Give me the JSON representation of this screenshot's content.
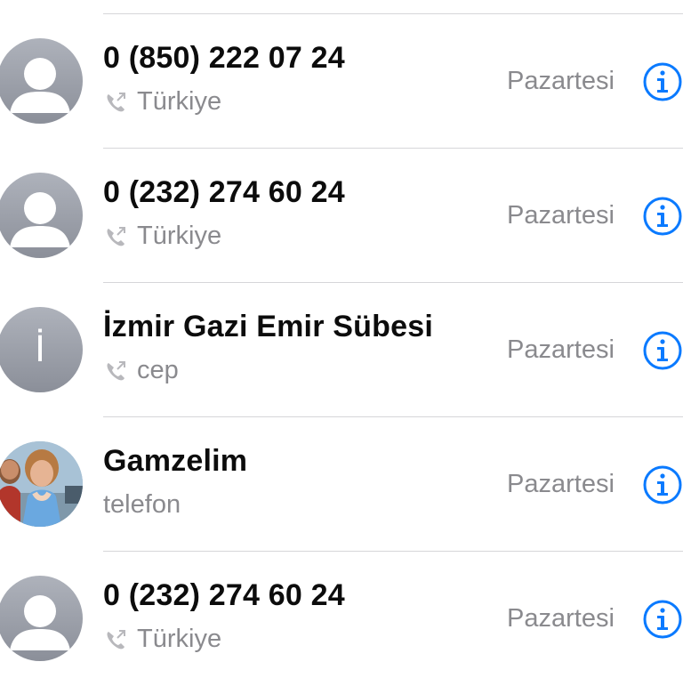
{
  "colors": {
    "accent": "#0a7aff",
    "secondary_text": "#8a8a8e",
    "separator": "#d6d6d9",
    "avatar_gray": "#9a9ea7"
  },
  "calls": [
    {
      "title": "0 (850) 222 07 24",
      "subtitle": "Türkiye",
      "date": "Pazartesi",
      "avatar": "generic-person-icon",
      "show_phone_icon": true
    },
    {
      "title": "0 (232) 274 60 24",
      "subtitle": "Türkiye",
      "date": "Pazartesi",
      "avatar": "generic-person-icon",
      "show_phone_icon": true
    },
    {
      "title": "İzmir Gazi Emir Sübesi",
      "subtitle": "cep",
      "date": "Pazartesi",
      "avatar": "initial",
      "avatar_initial": "İ",
      "show_phone_icon": true
    },
    {
      "title": "Gamzelim",
      "subtitle": "telefon",
      "date": "Pazartesi",
      "avatar": "contact-photo",
      "show_phone_icon": false
    },
    {
      "title": "0 (232) 274 60 24",
      "subtitle": "Türkiye",
      "date": "Pazartesi",
      "avatar": "generic-person-icon",
      "show_phone_icon": true
    }
  ]
}
